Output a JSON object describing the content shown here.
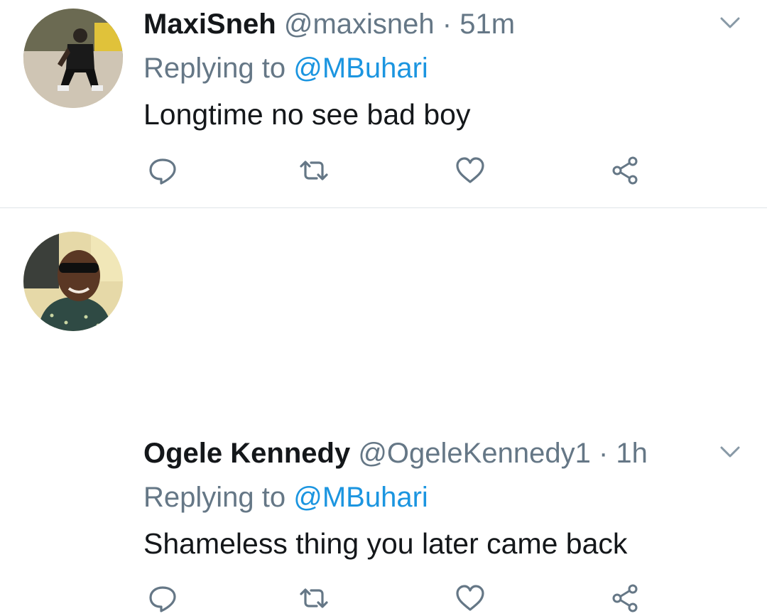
{
  "tweets": [
    {
      "name": "MaxiSneh",
      "handle": "@maxisneh",
      "separator": "·",
      "time": "51m",
      "replying_prefix": "Replying to",
      "replying_to": "@MBuhari",
      "text": "Longtime no see bad boy"
    },
    {
      "name": "Ogele Kennedy",
      "handle": "@OgeleKennedy1",
      "separator": "·",
      "time": "1h",
      "replying_prefix": "Replying to",
      "replying_to": "@MBuhari",
      "text": "Shameless thing you later came back"
    }
  ],
  "icons": {
    "caret": "chevron-down-icon",
    "reply": "reply-icon",
    "retweet": "retweet-icon",
    "like": "heart-icon",
    "share": "share-icon"
  },
  "colors": {
    "secondary_text": "#657786",
    "link": "#1b95e0",
    "icon": "#657786",
    "divider": "#dfe4e8"
  }
}
